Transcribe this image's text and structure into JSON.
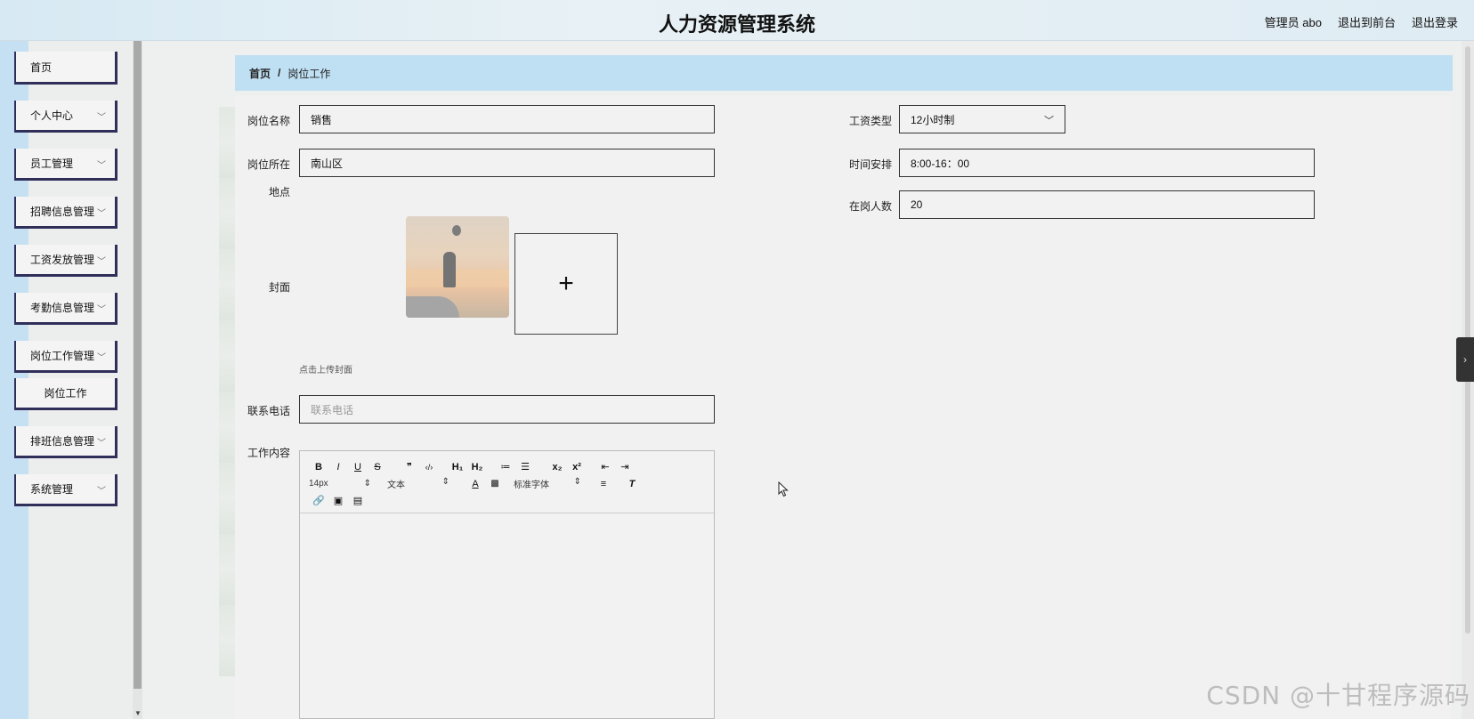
{
  "header": {
    "title": "人力资源管理系统",
    "admin_label": "管理员 abo",
    "front_link": "退出到前台",
    "logout_link": "退出登录"
  },
  "sidebar": {
    "items": [
      {
        "label": "首页",
        "has_chevron": false
      },
      {
        "label": "个人中心",
        "has_chevron": true
      },
      {
        "label": "员工管理",
        "has_chevron": true
      },
      {
        "label": "招聘信息管理",
        "has_chevron": true
      },
      {
        "label": "工资发放管理",
        "has_chevron": true
      },
      {
        "label": "考勤信息管理",
        "has_chevron": true
      },
      {
        "label": "岗位工作管理",
        "has_chevron": true
      },
      {
        "label": "岗位工作",
        "has_chevron": false,
        "submenu": true
      },
      {
        "label": "排班信息管理",
        "has_chevron": true
      },
      {
        "label": "系统管理",
        "has_chevron": true
      }
    ]
  },
  "breadcrumb": {
    "home": "首页",
    "separator": "/",
    "current": "岗位工作"
  },
  "form": {
    "position_name": {
      "label": "岗位名称",
      "value": "销售"
    },
    "location": {
      "label_line1": "岗位所在",
      "label_line2": "地点",
      "value": "南山区"
    },
    "cover": {
      "label": "封面",
      "upload_hint": "点击上传封面",
      "upload_icon": "+"
    },
    "phone": {
      "label": "联系电话",
      "placeholder": "联系电话",
      "value": ""
    },
    "content": {
      "label": "工作内容"
    },
    "salary_type": {
      "label": "工资类型",
      "value": "12小时制"
    },
    "schedule": {
      "label": "时间安排",
      "value": "8:00-16：00"
    },
    "headcount": {
      "label": "在岗人数",
      "value": "20"
    }
  },
  "editor": {
    "row1": [
      "B",
      "I",
      "U",
      "S",
      "❞",
      "‹/›",
      "H₁",
      "H₂",
      "≔",
      "☰",
      "x₂",
      "x²",
      "⇤",
      "⇥"
    ],
    "font_size": "14px",
    "text_style": "文本",
    "font_family": "标准字体",
    "row3_icons": [
      "link-icon",
      "image-icon",
      "video-icon"
    ]
  },
  "watermark": "CSDN @十甘程序源码",
  "colors": {
    "breadcrumb_bg": "#bfdff2",
    "sidebar_border": "#2f2f5a",
    "left_strip": "#c4e0f2"
  }
}
